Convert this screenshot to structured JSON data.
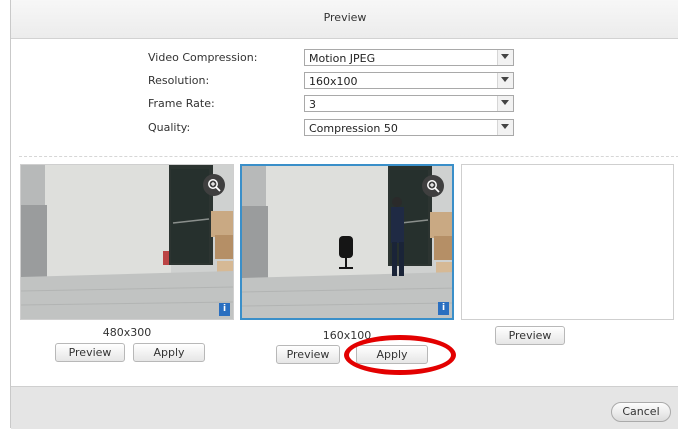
{
  "dialog": {
    "title": "Preview"
  },
  "settings": [
    {
      "label": "Video Compression:",
      "value": "Motion JPEG"
    },
    {
      "label": "Resolution:",
      "value": "160x100"
    },
    {
      "label": "Frame Rate:",
      "value": "3"
    },
    {
      "label": "Quality:",
      "value": "Compression 50"
    }
  ],
  "previews": [
    {
      "resolution": "480x300",
      "preview_label": "Preview",
      "apply_label": "Apply"
    },
    {
      "resolution": "160x100",
      "preview_label": "Preview",
      "apply_label": "Apply"
    },
    {
      "resolution": "",
      "preview_label": "Preview"
    }
  ],
  "footer": {
    "cancel_label": "Cancel"
  },
  "colors": {
    "selected_border": "#3a8fc9",
    "highlight": "#e30000",
    "info_badge": "#2a6fc0"
  },
  "icons": {
    "zoom": "zoom-in-icon",
    "info": "info-icon",
    "dropdown": "chevron-down-icon"
  }
}
